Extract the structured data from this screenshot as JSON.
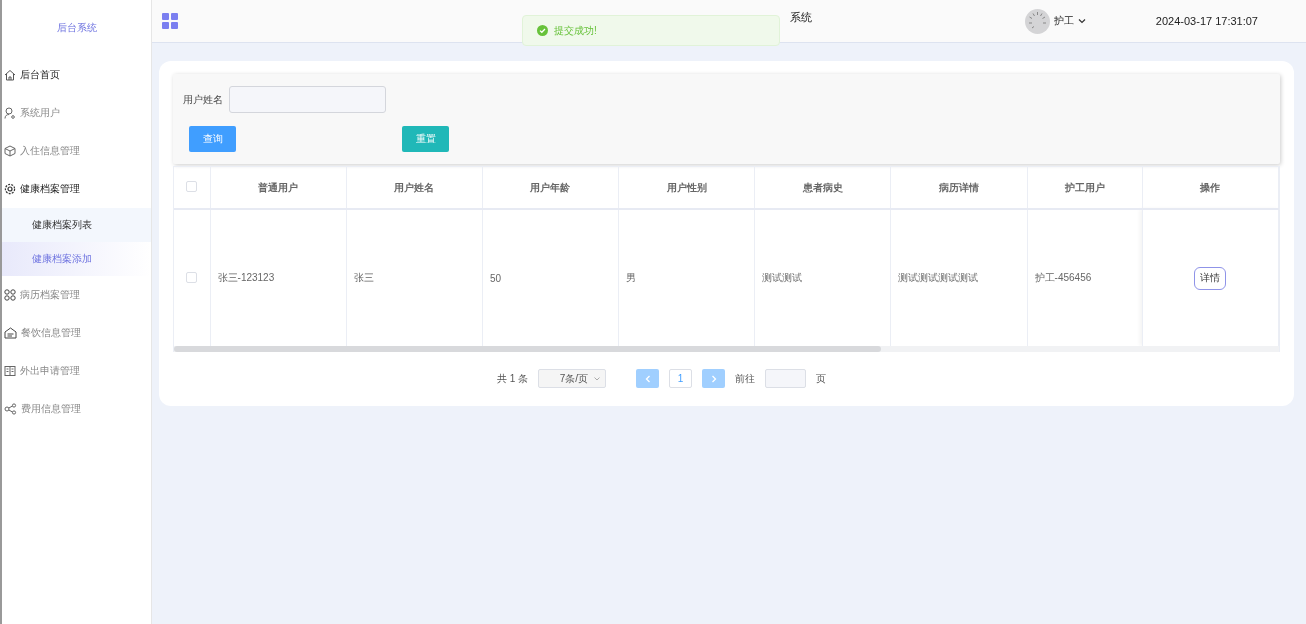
{
  "sidebar": {
    "title": "后台系统",
    "items": [
      {
        "label": "后台首页",
        "active": true
      },
      {
        "label": "系统用户",
        "active": false
      },
      {
        "label": "入住信息管理",
        "active": false
      },
      {
        "label": "健康档案管理",
        "active": true,
        "children": [
          {
            "label": "健康档案列表",
            "selected": false,
            "hovered": true
          },
          {
            "label": "健康档案添加",
            "selected": true,
            "hovered": false
          }
        ]
      },
      {
        "label": "病历档案管理",
        "active": false
      },
      {
        "label": "餐饮信息管理",
        "active": false
      },
      {
        "label": "外出申请管理",
        "active": false
      },
      {
        "label": "费用信息管理",
        "active": false
      }
    ]
  },
  "header": {
    "title": "系统",
    "user": "护工",
    "datetime": "2024-03-17 17:31:07"
  },
  "toast": {
    "message": "提交成功!"
  },
  "search": {
    "fields": [
      {
        "label": "用户姓名"
      }
    ],
    "buttons": [
      {
        "label": "查询",
        "kind": "primary"
      },
      {
        "label": "重置",
        "kind": "reset"
      }
    ]
  },
  "table": {
    "all_checked": false,
    "columns": [
      "普通用户",
      "用户姓名",
      "用户年龄",
      "用户性别",
      "患者病史",
      "病历详情",
      "护工用户",
      "操作"
    ],
    "rows": [
      {
        "checked": false,
        "cells": [
          "张三-123123",
          "张三",
          "50",
          "男",
          "测试测试",
          "测试测试测试测试",
          "护工-456456"
        ],
        "action": "详情"
      }
    ]
  },
  "pagination": {
    "total": "共 1 条",
    "page_size": "7条/页",
    "prev_disabled": true,
    "next_disabled": true,
    "pages": [
      {
        "label": "1",
        "selected": true
      }
    ],
    "goto_label": "前往",
    "goto_suffix": "页"
  }
}
